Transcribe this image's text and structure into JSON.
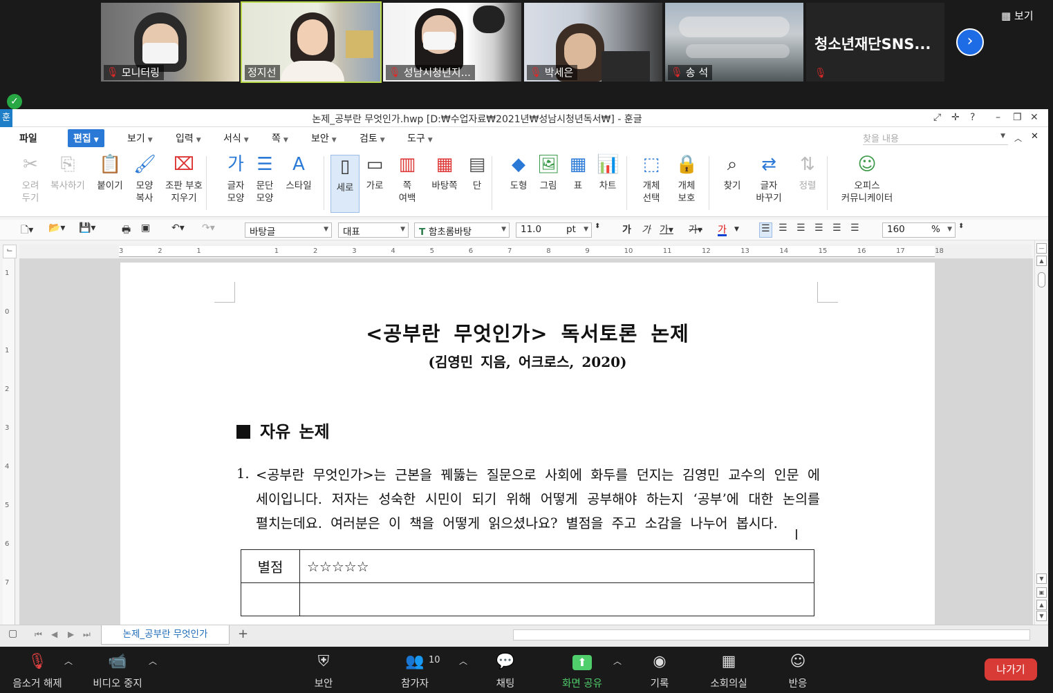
{
  "zoom": {
    "participants": [
      {
        "name": "모니터링",
        "muted": true
      },
      {
        "name": "정지선",
        "muted": false
      },
      {
        "name": "성남시청년지...",
        "muted": true
      },
      {
        "name": "박세은",
        "muted": true
      },
      {
        "name": "송 석",
        "muted": true
      }
    ],
    "group_tile": {
      "label": "청소년재단SNS..."
    },
    "view_button": "보기",
    "toolbar": [
      {
        "label": "음소거 해제",
        "icon": "mic-muted-icon"
      },
      {
        "label": "비디오 중지",
        "icon": "video-camera-icon"
      },
      {
        "label": "보안",
        "icon": "shield-icon"
      },
      {
        "label": "참가자",
        "icon": "participants-icon",
        "count": "10"
      },
      {
        "label": "채팅",
        "icon": "chat-icon"
      },
      {
        "label": "화면 공유",
        "icon": "share-screen-icon"
      },
      {
        "label": "기록",
        "icon": "record-icon"
      },
      {
        "label": "소회의실",
        "icon": "breakout-rooms-icon"
      },
      {
        "label": "반응",
        "icon": "reaction-icon"
      }
    ],
    "leave_button": "나가기",
    "accent_green": "#4fce6b",
    "leave_color": "#d83a35"
  },
  "hwp": {
    "window_title": "논제_공부란 무엇인가.hwp [D:₩수업자료₩2021년₩성남시청년독서₩] - 훈글",
    "app_icon": "훈",
    "menus": [
      "파일",
      "편집",
      "보기",
      "입력",
      "서식",
      "쪽",
      "보안",
      "검토",
      "도구"
    ],
    "active_menu": "편집",
    "find_placeholder": "찾을 내용",
    "ribbon": [
      {
        "label1": "오려",
        "label2": "두기",
        "icon": "scissors-icon",
        "disabled": true
      },
      {
        "label1": "복사하기",
        "label2": "",
        "icon": "copy-icon",
        "disabled": true
      },
      {
        "label1": "붙이기",
        "label2": "",
        "icon": "paste-icon",
        "disabled": false
      },
      {
        "label1": "모양",
        "label2": "복사",
        "icon": "format-painter-icon",
        "disabled": false
      },
      {
        "label1": "조판 부호",
        "label2": "지우기",
        "icon": "clear-codes-icon",
        "disabled": false
      },
      {
        "label1": "글자",
        "label2": "모양",
        "icon": "char-shape-icon",
        "disabled": false
      },
      {
        "label1": "문단",
        "label2": "모양",
        "icon": "para-shape-icon",
        "disabled": false
      },
      {
        "label1": "스타일",
        "label2": "",
        "icon": "style-icon",
        "disabled": false
      },
      {
        "label1": "세로",
        "label2": "",
        "icon": "portrait-icon",
        "disabled": false
      },
      {
        "label1": "가로",
        "label2": "",
        "icon": "landscape-icon",
        "disabled": false
      },
      {
        "label1": "쪽",
        "label2": "여백",
        "icon": "margin-icon",
        "disabled": false
      },
      {
        "label1": "바탕쪽",
        "label2": "",
        "icon": "master-page-icon",
        "disabled": false
      },
      {
        "label1": "단",
        "label2": "",
        "icon": "columns-icon",
        "disabled": false
      },
      {
        "label1": "도형",
        "label2": "",
        "icon": "shapes-icon",
        "disabled": false
      },
      {
        "label1": "그림",
        "label2": "",
        "icon": "picture-icon",
        "disabled": false
      },
      {
        "label1": "표",
        "label2": "",
        "icon": "table-icon",
        "disabled": false
      },
      {
        "label1": "차트",
        "label2": "",
        "icon": "chart-icon",
        "disabled": false
      },
      {
        "label1": "개체",
        "label2": "선택",
        "icon": "select-object-icon",
        "disabled": false
      },
      {
        "label1": "개체",
        "label2": "보호",
        "icon": "protect-object-icon",
        "disabled": false
      },
      {
        "label1": "찾기",
        "label2": "",
        "icon": "binoculars-icon",
        "disabled": false
      },
      {
        "label1": "글자",
        "label2": "바꾸기",
        "icon": "replace-icon",
        "disabled": false
      },
      {
        "label1": "정렬",
        "label2": "",
        "icon": "sort-icon",
        "disabled": true
      },
      {
        "label1": "오피스",
        "label2": "커뮤니케이터",
        "icon": "office-communicator-icon",
        "disabled": false
      }
    ],
    "format": {
      "style": "바탕글",
      "lang": "대표",
      "font": "함초롬바탕",
      "size": "11.0",
      "unit": "pt",
      "zoom": "160",
      "zoom_unit": "%"
    },
    "ruler_ticks": [
      "3",
      "2",
      "1",
      "",
      "1",
      "2",
      "3",
      "4",
      "5",
      "6",
      "7",
      "8",
      "9",
      "10",
      "11",
      "12",
      "13",
      "14",
      "15",
      "16",
      "17",
      "18"
    ],
    "vruler_ticks": [
      "1",
      "0",
      "1",
      "2",
      "3",
      "4",
      "5",
      "6",
      "7"
    ],
    "document": {
      "title": "<공부란 무엇인가> 독서토론 논제",
      "subtitle": "(김영민 지음, 어크로스, 2020)",
      "section": "자유 논제",
      "q1_num": "1.",
      "q1_text": "<공부란 무엇인가>는 근본을 꿰뚫는 질문으로 사회에 화두를 던지는 김영민 교수의 인문 에세이입니다. 저자는 성숙한 시민이 되기 위해 어떻게 공부해야 하는지 ‘공부’에 대한 논의를 펼치는데요. 여러분은 이 책을 어떻게 읽으셨나요? 별점을 주고 소감을 나누어 봅시다.",
      "table_label": "별점",
      "table_value": "☆☆☆☆☆"
    },
    "doc_tab": "논제_공부란 무엇인가"
  }
}
